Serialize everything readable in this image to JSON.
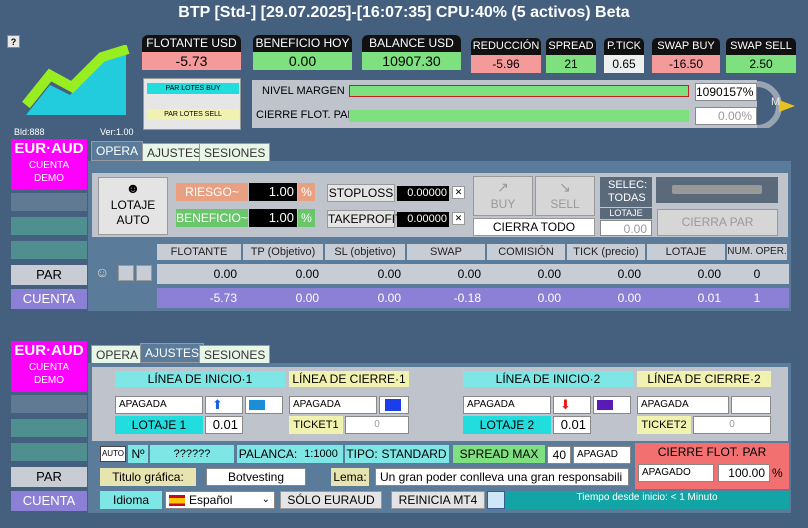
{
  "title": "BTP [Std-] [29.07.2025]-[16:07:35] CPU:40% (5 activos) Beta",
  "help": "?",
  "logo": {
    "bld": "Bld:888",
    "ver": "Ver:1.00"
  },
  "stats": [
    {
      "label": "FLOTANTE USD",
      "value": "-5.73",
      "color": "pink"
    },
    {
      "label": "BENEFICIO HOY",
      "value": "0.00",
      "color": "green"
    },
    {
      "label": "BALANCE USD",
      "value": "10907.30",
      "color": "green"
    }
  ],
  "small_stats": [
    {
      "label": "REDUCCIÓN",
      "value": "-5.96",
      "color": "pink"
    },
    {
      "label": "SPREAD",
      "value": "21",
      "color": "green"
    },
    {
      "label": "P.TICK",
      "value": "0.65",
      "color": "light"
    },
    {
      "label": "SWAP BUY",
      "value": "-16.50",
      "color": "pink"
    },
    {
      "label": "SWAP SELL",
      "value": "2.50",
      "color": "green"
    }
  ],
  "lotes": {
    "buy": "PAR LOTES BUY",
    "sell": "PAR LOTES SELL"
  },
  "margin": {
    "label": "NIVEL MARGEN",
    "value": "1090157%",
    "close_label": "CIERRE FLOT. PAR",
    "close_value": "0.00%"
  },
  "gauge": "M",
  "panel1": {
    "symbol": "EUR·AUD",
    "account": "CUENTA DEMO",
    "tabs": [
      "OPERA",
      "AJUSTES",
      "SESIONES"
    ],
    "lotaje_auto": "LOTAJE AUTO",
    "riesgo_label": "RIESGO~",
    "riesgo_value": "1.00",
    "beneficio_label": "BENEFICIO~",
    "beneficio_value": "1.00",
    "pct": "%",
    "stoploss": "STOPLOSS",
    "stoploss_value": "0.00000",
    "takeprofit": "TAKEPROFIT",
    "takeprofit_value": "0.00000",
    "x": "✕",
    "buy": "BUY",
    "sell": "SELL",
    "cierra_todo": "CIERRA TODO",
    "selec": "SELEC: TODAS",
    "lotaje": "LOTAJE",
    "lotaje_value": "0.00",
    "cierra_par": "CIERRA PAR",
    "columns": [
      "FLOTANTE",
      "TP (Objetivo)",
      "SL (objetivo)",
      "SWAP",
      "COMISIÓN",
      "TICK (precio)",
      "LOTAJE",
      "NUM. OPER."
    ],
    "row_par": {
      "label": "PAR",
      "values": [
        "0.00",
        "0.00",
        "0.00",
        "0.00",
        "0.00",
        "0.00",
        "0.00",
        "0"
      ]
    },
    "row_cuenta": {
      "label": "CUENTA",
      "values": [
        "-5.73",
        "0.00",
        "0.00",
        "-0.18",
        "0.00",
        "0.00",
        "0.01",
        "1"
      ]
    }
  },
  "panel2": {
    "symbol": "EUR·AUD",
    "account": "CUENTA DEMO",
    "tabs": [
      "OPERA",
      "AJUSTES",
      "SESIONES"
    ],
    "inicio1": "LÍNEA DE INICIO·1",
    "cierre1": "LÍNEA DE CIERRE·1",
    "inicio2": "LÍNEA DE INICIO·2",
    "cierre2": "LÍNEA DE CIERRE·2",
    "apagada": "APAGADA",
    "lotaje1": "LOTAJE 1",
    "lotaje1_value": "0.01",
    "ticket1": "TICKET1",
    "ticket1_value": "0",
    "lotaje2": "LOTAJE 2",
    "lotaje2_value": "0.01",
    "ticket2": "TICKET2",
    "ticket2_value": "0",
    "auto": "AUTO",
    "num_label": "Nº",
    "num_value": "??????",
    "palanca_label": "PALANCA:",
    "palanca_value": "1:1000",
    "tipo_label": "TIPO:",
    "tipo_value": "STANDARD",
    "spread_max": "SPREAD MAX",
    "spread_max_value": "40",
    "apagad": "APAGAD",
    "cierre_flot": "CIERRE FLOT. PAR",
    "apagado": "APAGADO",
    "cierre_value": "100.00",
    "pct": "%",
    "titulo_label": "Titulo gráfica:",
    "titulo_value": "Botvesting",
    "lema_label": "Lema:",
    "lema_value": "Un gran poder conlleva una gran responsabili",
    "idioma_label": "Idioma",
    "idioma_value": "Español",
    "solo": "SÓLO EURAUD",
    "reinicia": "REINICIA MT4",
    "tiempo": "Tiempo desde inicio:  < 1 Minuto",
    "par": "PAR",
    "cuenta": "CUENTA"
  },
  "colors": {
    "bg": "#44607e",
    "magenta": "#ff00ff",
    "cyan": "#22dddd",
    "pink": "#f49a9a",
    "green": "#7ee07e"
  }
}
